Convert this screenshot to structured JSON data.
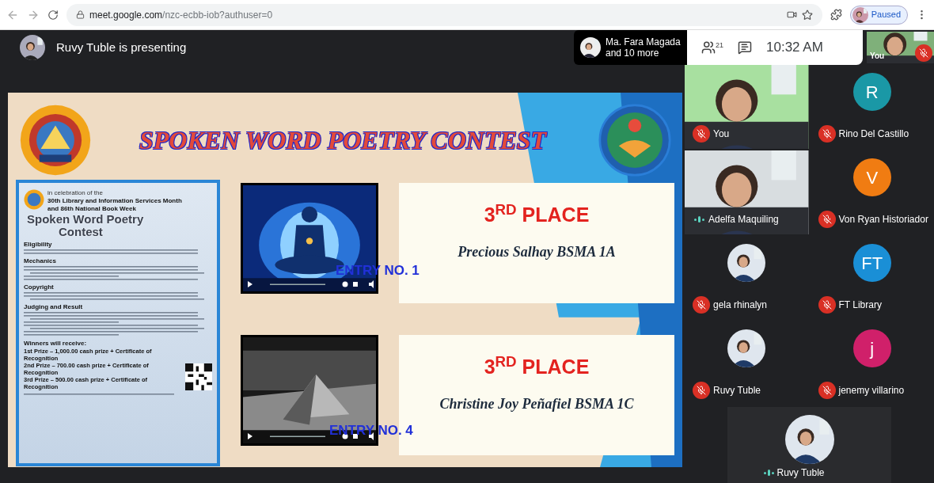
{
  "browser": {
    "url_host": "meet.google.com",
    "url_path": "/nzc-ecbb-iob?authuser=0",
    "profile_status": "Paused"
  },
  "meeting": {
    "presenting_label": "Ruvy Tuble is presenting",
    "speaker_name": "Ma. Fara Magada",
    "speaker_more": "and 10 more",
    "participant_count": "21",
    "time": "10:32 AM"
  },
  "self_view": {
    "label": "You",
    "muted": true
  },
  "slide": {
    "title": "SPOKEN WORD POETRY CONTEST",
    "poster": {
      "intro": "in celebration of the",
      "heading_lines": [
        "30th Library and Information Services Month",
        "and 86th National Book Week"
      ],
      "title_lines": [
        "Spoken Word Poetry",
        "Contest"
      ],
      "sections": [
        "Eligibility",
        "Mechanics",
        "Copyright",
        "Judging and Result"
      ],
      "prizes_heading": "Winners will receive:",
      "prizes": [
        "1st Prize – 1,000.00 cash prize + Certificate of Recognition",
        "2nd Prize – 700.00 cash prize + Certificate of Recognition",
        "3rd Prize – 500.00 cash prize + Certificate of Recognition"
      ]
    },
    "entries": [
      {
        "label": "ENTRY NO. 1",
        "place": "3$^{RD}$ PLACE",
        "winner": "Precious Salhay BSMA 1A",
        "kind": "meditation"
      },
      {
        "label": "ENTRY NO. 4",
        "place": "3$^{RD}$ PLACE",
        "winner": "Christine Joy Peñafiel BSMA 1C",
        "kind": "sign"
      }
    ]
  },
  "tiles": [
    {
      "kind": "video",
      "name": "You",
      "muted": true
    },
    {
      "kind": "initial",
      "initial": "R",
      "color": "#1a98a6",
      "name": "Rino Del Castillo",
      "muted": true
    },
    {
      "kind": "video",
      "name": "Adelfa Maquiling",
      "muted": false
    },
    {
      "kind": "initial",
      "initial": "V",
      "color": "#f07c12",
      "name": "Von Ryan Historiador",
      "muted": true
    },
    {
      "name": "gela rhinalyn",
      "muted": true
    },
    {
      "kind": "initial",
      "initial": "FT",
      "color": "#1a8fd6",
      "name": "FT Library",
      "muted": true
    },
    {
      "name": "Ruvy Tuble",
      "muted": true
    },
    {
      "kind": "initial",
      "initial": "j",
      "color": "#d0206a",
      "name": "jenemy villarino",
      "muted": true
    }
  ],
  "bottom_tile": {
    "name": "Ruvy Tuble",
    "muted": false
  }
}
